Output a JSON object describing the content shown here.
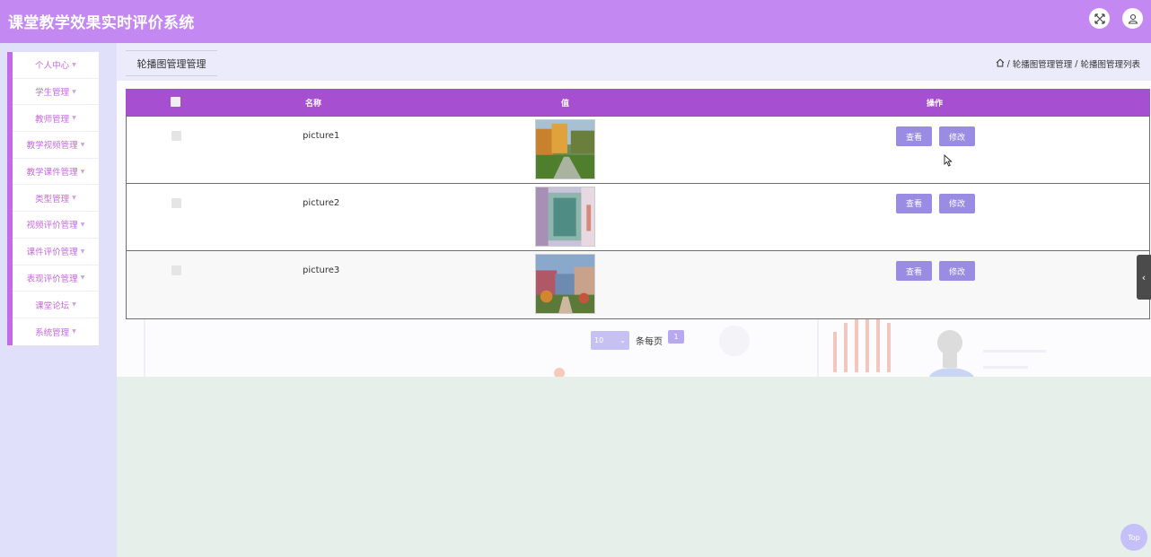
{
  "app": {
    "title": "课堂教学效果实时评价系统"
  },
  "header": {
    "fullscreen_icon": "fullscreen-icon",
    "user_icon": "user-icon"
  },
  "sidebar": {
    "items": [
      {
        "label": "个人中心"
      },
      {
        "label": "学生管理"
      },
      {
        "label": "教师管理"
      },
      {
        "label": "教学视频管理"
      },
      {
        "label": "教学课件管理"
      },
      {
        "label": "类型管理"
      },
      {
        "label": "视频评价管理"
      },
      {
        "label": "课件评价管理"
      },
      {
        "label": "表现评价管理"
      },
      {
        "label": "课堂论坛"
      },
      {
        "label": "系统管理"
      }
    ]
  },
  "page_tab": {
    "label": "轮播图管理管理"
  },
  "breadcrumb": {
    "sep": "/",
    "items": [
      "轮播图管理管理",
      "轮播图管理列表"
    ]
  },
  "table": {
    "columns": {
      "name": "名称",
      "value": "值",
      "action": "操作"
    },
    "rows": [
      {
        "name": "picture1",
        "view_label": "查看",
        "edit_label": "修改"
      },
      {
        "name": "picture2",
        "view_label": "查看",
        "edit_label": "修改"
      },
      {
        "name": "picture3",
        "view_label": "查看",
        "edit_label": "修改"
      }
    ]
  },
  "pager": {
    "page_size": "10",
    "per_page_label": "条每页",
    "current_page": "1"
  },
  "top_button": {
    "label": "Top"
  },
  "colors": {
    "header": "#c388f1",
    "table_header": "#a64fd0",
    "button": "#9a8ce2",
    "sidebar_accent": "#c26be6"
  }
}
